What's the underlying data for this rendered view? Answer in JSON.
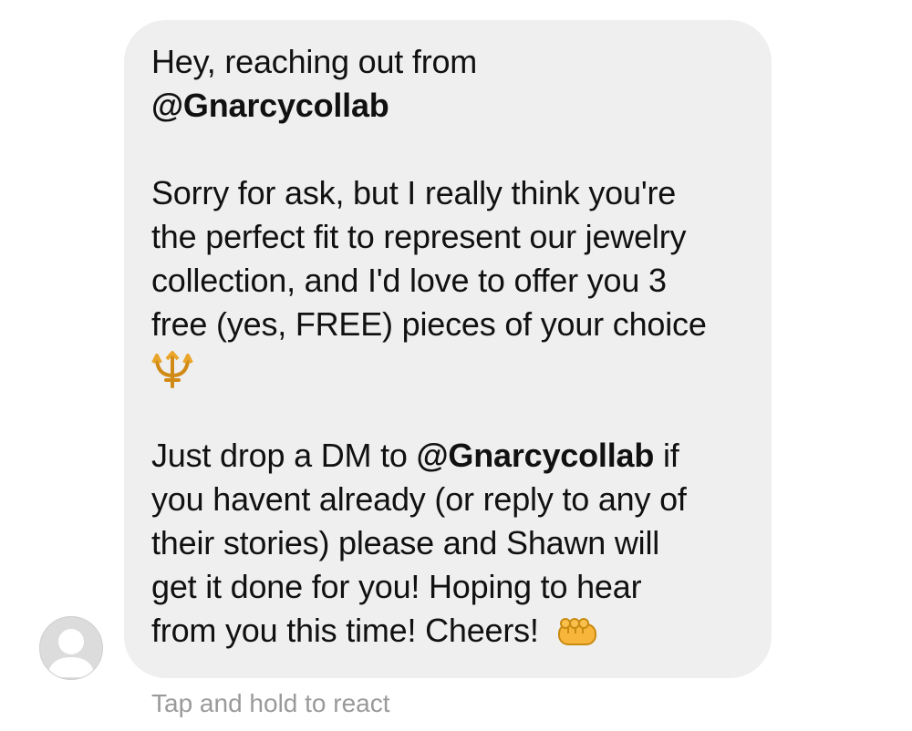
{
  "message": {
    "intro": "Hey, reaching out from",
    "handle": "@Gnarcycollab",
    "body1": [
      "Sorry for ask, but I really think you're",
      "the perfect fit to represent our jewelry",
      "collection, and I'd love to offer you 3",
      "free (yes, FREE) pieces of your choice"
    ],
    "emoji1": "trident-emoji",
    "body2_start": "Just drop a DM to ",
    "body2_handle": "@Gnarcycollab",
    "body2_end": " if",
    "body2_lines": [
      "you havent already (or reply to any of",
      "their stories) please and Shawn will",
      "get it done for you! Hoping to hear"
    ],
    "closing": "from you this time! Cheers!",
    "emoji2": "fist-emoji"
  },
  "footer": {
    "hint": "Tap and hold to react"
  },
  "colors": {
    "bubble": "#efefef",
    "text": "#111111",
    "hint": "#9a9a9a",
    "avatar": "#dcdcdc"
  }
}
